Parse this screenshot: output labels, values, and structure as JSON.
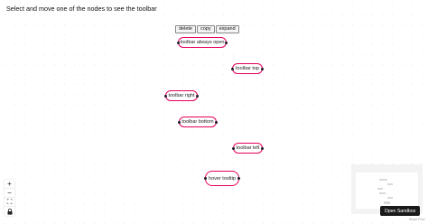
{
  "heading": "Select and move one of the nodes to see the toolbar",
  "toolbar": {
    "delete_label": "delete",
    "copy_label": "copy",
    "expand_label": "expand"
  },
  "nodes": [
    {
      "label": "toolbar always open"
    },
    {
      "label": "toolbar top"
    },
    {
      "label": "toolbar right"
    },
    {
      "label": "toolbar bottom"
    },
    {
      "label": "toolbar left"
    },
    {
      "label": "hover tooltip"
    }
  ],
  "controls": {
    "zoom_in": "+",
    "zoom_out": "−",
    "fit_view": "⛶",
    "lock": "🔒"
  },
  "colors": {
    "node_border": "#e4005a",
    "handle": "#1a192b"
  },
  "minimap_label": "minimap",
  "sandbox_button": "Open Sandbox",
  "attribution": "React Flow"
}
